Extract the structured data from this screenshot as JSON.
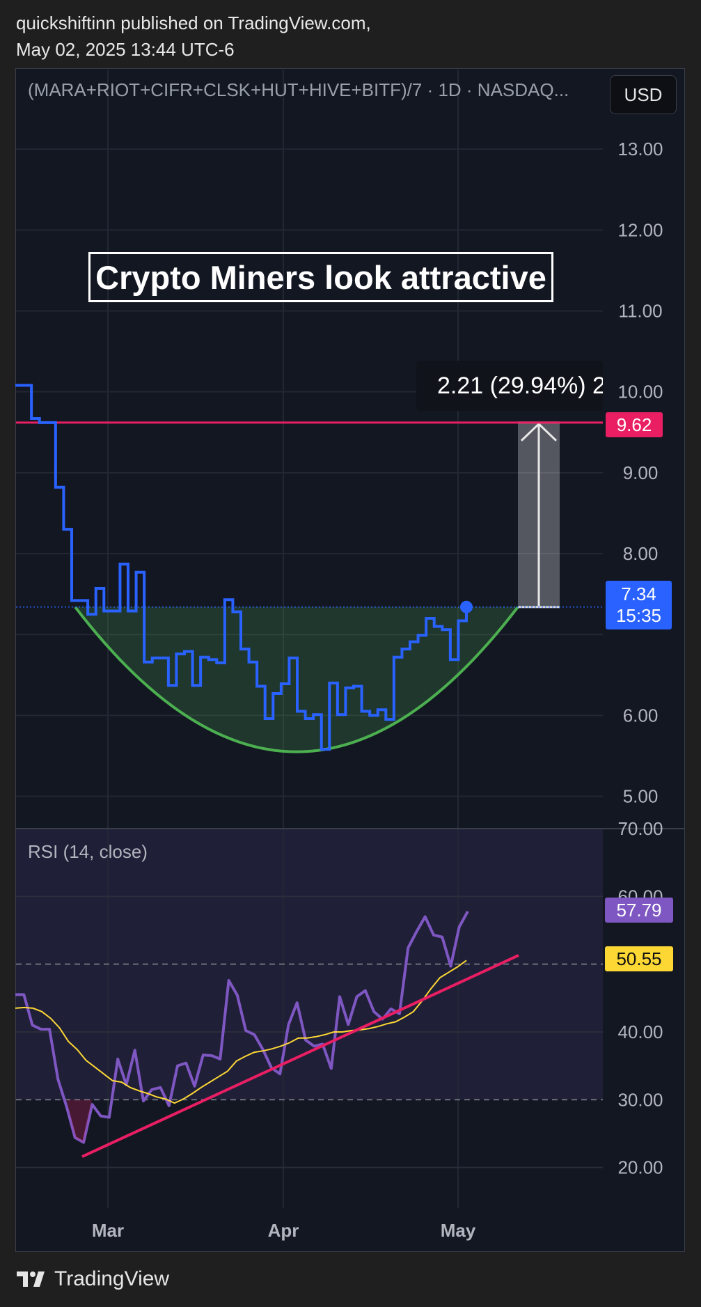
{
  "header": {
    "line1": "quickshiftinn published on TradingView.com,",
    "line2": "May 02, 2025 13:44 UTC-6"
  },
  "symbol": "(MARA+RIOT+CIFR+CLSK+HUT+HIVE+BITF)/7 · 1D · NASDAQ...",
  "currency": "USD",
  "annotation_title": "Crypto Miners look attractive",
  "measure_label": "2.21 (29.94%) 2",
  "price_tags": {
    "resistance": "9.62",
    "last": "7.34",
    "countdown": "15:35"
  },
  "rsi_label": "RSI (14, close)",
  "rsi_tags": {
    "rsi": "57.79",
    "ma": "50.55"
  },
  "footer": {
    "brand": "TradingView"
  },
  "colors": {
    "price": "#2962ff",
    "resistance": "#e91e63",
    "cup": "#4caf50",
    "rsi": "#7e57c2",
    "rsi_ma": "#fdd835",
    "trend": "#e91e63"
  },
  "chart_data": [
    {
      "type": "line",
      "series": [
        {
          "values": [
            10.08,
            10.08,
            9.67,
            9.62,
            9.62,
            8.82,
            8.3,
            7.42,
            7.42,
            7.25,
            7.57,
            7.29,
            7.29,
            7.87,
            7.29,
            7.77,
            6.66,
            6.71,
            6.71,
            6.37,
            6.76,
            6.79,
            6.37,
            6.72,
            6.69,
            6.65,
            7.43,
            7.28,
            6.82,
            6.66,
            6.36,
            5.96,
            6.27,
            6.39,
            6.71,
            6.05,
            5.96,
            6.01,
            5.58,
            6.4,
            6.01,
            6.34,
            6.36,
            6.05,
            6.0,
            6.07,
            5.95,
            6.72,
            6.82,
            6.91,
            6.99,
            7.2,
            7.1,
            7.06,
            6.69,
            7.17,
            7.34
          ]
        }
      ],
      "x_labels": [
        "Mar",
        "Apr",
        "May"
      ],
      "y_ticks": [
        "13.00",
        "12.00",
        "11.00",
        "10.00",
        "9.00",
        "8.00",
        "6.00",
        "5.00"
      ],
      "ylim": [
        4.6,
        14.0
      ],
      "resistance_level": 9.62,
      "last_price": 7.34,
      "cup_bottom": 5.55,
      "measure": {
        "from": 7.34,
        "to": 9.62,
        "change": "2.21 (29.94%)"
      },
      "grid": true
    },
    {
      "type": "line",
      "title": "RSI (14, close)",
      "series": [
        {
          "values": [
            45.5,
            45.5,
            41.0,
            40.4,
            40.4,
            33.0,
            29.0,
            24.4,
            23.7,
            29.3,
            27.6,
            27.4,
            36.0,
            32.2,
            37.3,
            29.8,
            31.5,
            31.8,
            29.1,
            35.0,
            35.4,
            32.0,
            36.6,
            36.5,
            36.0,
            47.6,
            45.4,
            40.2,
            39.6,
            37.4,
            34.7,
            33.8,
            41.1,
            44.3,
            38.8,
            37.9,
            38.2,
            34.6,
            45.2,
            41.1,
            45.2,
            46.1,
            43.0,
            41.9,
            43.4,
            42.7,
            52.4,
            54.8,
            57.0,
            54.3,
            54.0,
            49.7,
            55.5,
            57.79
          ]
        },
        {
          "values": [
            43.5,
            43.6,
            43.5,
            43.0,
            42.0,
            40.6,
            38.6,
            37.4,
            35.8,
            34.8,
            33.8,
            32.8,
            32.6,
            31.8,
            31.3,
            30.9,
            30.4,
            30.1,
            29.5,
            30.1,
            30.9,
            31.8,
            32.6,
            33.4,
            34.2,
            35.7,
            36.4,
            37.0,
            37.2,
            37.5,
            37.9,
            38.4,
            39.1,
            39.1,
            39.3,
            39.6,
            40.0,
            40.0,
            40.2,
            40.3,
            40.5,
            40.8,
            41.2,
            41.5,
            42.2,
            43.0,
            44.6,
            46.4,
            48.0,
            48.8,
            49.6,
            50.55
          ]
        }
      ],
      "y_ticks": [
        "70.00",
        "60.00",
        "40.00",
        "30.00",
        "20.00"
      ],
      "ylim": [
        14.0,
        70.0
      ],
      "bands": [
        30,
        50,
        70
      ],
      "trendline": {
        "from": 21.6,
        "to": 51.3
      }
    }
  ]
}
